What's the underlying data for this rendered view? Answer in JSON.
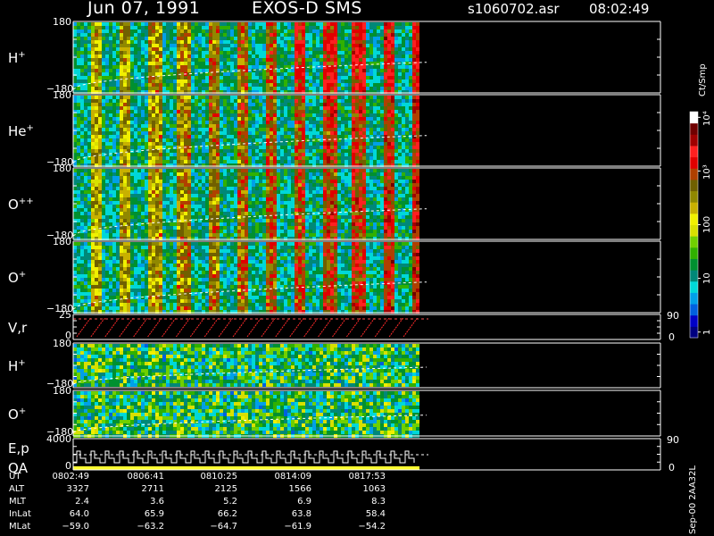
{
  "header": {
    "date": "Jun 07, 1991",
    "instrument": "EXOS-D SMS",
    "file": "s1060702.asr",
    "time": "08:02:49"
  },
  "chart_data": [
    {
      "type": "heatmap",
      "label_main": "H",
      "label_sup": "+",
      "ytick_top": "180",
      "ytick_bottom": "−180",
      "color_note": "spin-period angle-time spectrogram; colors low (blue) to high (red)"
    },
    {
      "type": "heatmap",
      "label_main": "He",
      "label_sup": "+",
      "ytick_top": "180",
      "ytick_bottom": "−180"
    },
    {
      "type": "heatmap",
      "label_main": "O",
      "label_sup": "++",
      "ytick_top": "180",
      "ytick_bottom": "−180"
    },
    {
      "type": "heatmap",
      "label_main": "O",
      "label_sup": "+",
      "ytick_top": "180",
      "ytick_bottom": "−180"
    },
    {
      "type": "line",
      "label_main": "V,r",
      "label_sup": "",
      "ytick_top": "25",
      "ytick_bottom": "0",
      "rtick_top": "90",
      "rtick_bottom": "0",
      "series_color": "#ff2a2a"
    },
    {
      "type": "heatmap",
      "label_main": "H",
      "label_sup": "+",
      "ytick_top": "180",
      "ytick_bottom": "−180"
    },
    {
      "type": "heatmap",
      "label_main": "O",
      "label_sup": "+",
      "ytick_top": "180",
      "ytick_bottom": "−180"
    },
    {
      "type": "line",
      "label_main": "E,p",
      "label_sup": "",
      "label2": "QA",
      "ytick_top": "4000",
      "ytick_bottom": "0",
      "rtick_top": "90",
      "rtick_bottom": "0"
    }
  ],
  "colorbar": {
    "unit": "Ct/Smp",
    "ticks": [
      {
        "v": 4,
        "text": "10⁴"
      },
      {
        "v": 3,
        "text": "10³"
      },
      {
        "v": 2,
        "text": "100"
      },
      {
        "v": 1,
        "text": "10"
      },
      {
        "v": 0,
        "text": "1"
      }
    ],
    "colors": [
      "#000080",
      "#0000c8",
      "#0060e0",
      "#00a0e8",
      "#00d8d8",
      "#008878",
      "#009030",
      "#30b000",
      "#70d000",
      "#d8e000",
      "#f0f000",
      "#c8b000",
      "#908800",
      "#706000",
      "#b04000",
      "#e00000",
      "#ff2020",
      "#a00000",
      "#700000",
      "#ffffff"
    ]
  },
  "footer": {
    "rows": [
      {
        "label": "UT",
        "values": [
          "0802:49",
          "0806:41",
          "0810:25",
          "0814:09",
          "0817:53"
        ]
      },
      {
        "label": "ALT",
        "values": [
          "3327",
          "2711",
          "2125",
          "1566",
          "1063"
        ]
      },
      {
        "label": "MLT",
        "values": [
          "2.4",
          "3.6",
          "5.2",
          "6.9",
          "8.3"
        ]
      },
      {
        "label": "InLat",
        "values": [
          "64.0",
          "65.9",
          "66.2",
          "63.8",
          "58.4"
        ]
      },
      {
        "label": "MLat",
        "values": [
          "−59.0",
          "−63.2",
          "−64.7",
          "−61.9",
          "−54.2"
        ]
      }
    ],
    "stamp": "Sep-00  2AA32L"
  }
}
